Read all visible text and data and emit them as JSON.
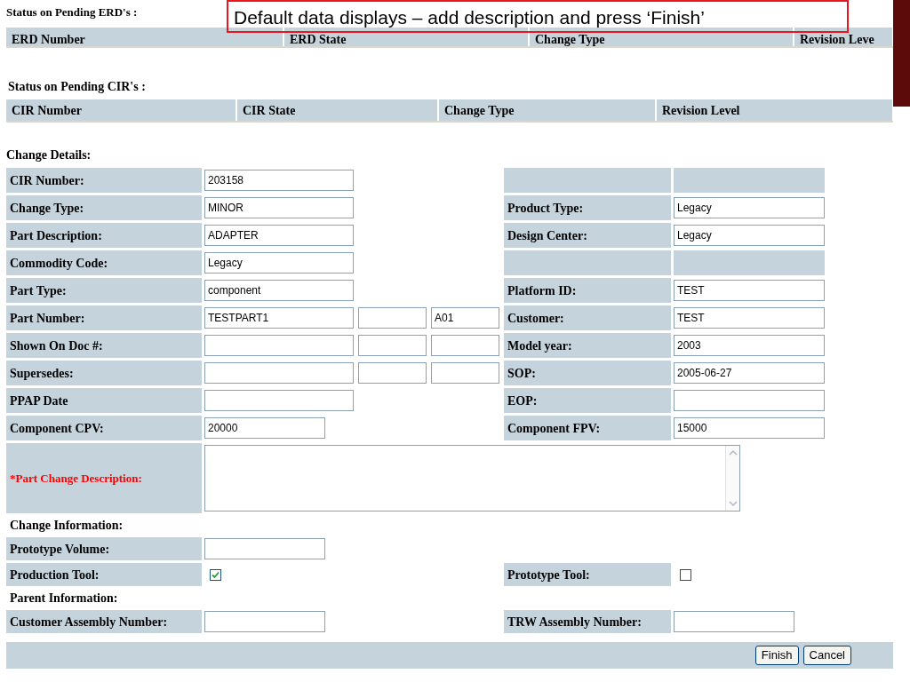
{
  "callout": {
    "text": "Default data displays – add description and press ‘Finish’"
  },
  "erd_section": {
    "title": "Status on Pending ERD's :",
    "columns": [
      "ERD Number",
      "ERD State",
      "Change Type",
      "Revision Leve"
    ]
  },
  "cir_section": {
    "title": "Status on Pending CIR's :",
    "columns": [
      "CIR Number",
      "CIR State",
      "Change Type",
      "Revision Level"
    ]
  },
  "change_details": {
    "title": "Change Details:",
    "rows": [
      {
        "label": "CIR Number:",
        "fields": [
          {
            "value": "203158"
          }
        ],
        "right": {
          "kind": "blank"
        }
      },
      {
        "label": "Change Type:",
        "fields": [
          {
            "value": "MINOR"
          }
        ],
        "right": {
          "kind": "field",
          "label": "Product Type:",
          "value": "Legacy"
        }
      },
      {
        "label": "Part Description:",
        "fields": [
          {
            "value": "ADAPTER"
          }
        ],
        "right": {
          "kind": "field",
          "label": "Design Center:",
          "value": "Legacy"
        }
      },
      {
        "label": "Commodity Code:",
        "fields": [
          {
            "value": "Legacy"
          }
        ],
        "right": {
          "kind": "blank"
        }
      },
      {
        "label": "Part Type:",
        "fields": [
          {
            "value": "component"
          }
        ],
        "right": {
          "kind": "field",
          "label": "Platform ID:",
          "value": "TEST"
        }
      },
      {
        "label": "Part Number:",
        "fields": [
          {
            "kind": "text",
            "value": "TESTPART1"
          },
          {
            "kind": "empty"
          },
          {
            "kind": "text",
            "value": "A01"
          }
        ],
        "right": {
          "kind": "field",
          "label": "Customer:",
          "value": "TEST"
        }
      },
      {
        "label": "Shown On Doc #:",
        "fields": [
          {
            "kind": "empty"
          },
          {
            "kind": "empty"
          },
          {
            "kind": "empty"
          }
        ],
        "right": {
          "kind": "field",
          "label": "Model year:",
          "value": "2003"
        }
      },
      {
        "label": "Supersedes:",
        "fields": [
          {
            "kind": "empty"
          },
          {
            "kind": "empty"
          },
          {
            "kind": "empty"
          }
        ],
        "right": {
          "kind": "field",
          "label": "SOP:",
          "value": "2005-06-27"
        }
      },
      {
        "label": "PPAP Date",
        "fields": [
          {
            "kind": "empty"
          }
        ],
        "right": {
          "kind": "field",
          "label": "EOP:"
        }
      },
      {
        "label": "Component CPV:",
        "fields": [
          {
            "value": "20000",
            "kind": "short"
          }
        ],
        "right": {
          "kind": "field",
          "label": "Component FPV:",
          "value": "15000"
        }
      }
    ],
    "description": {
      "label": "*Part Change Description:",
      "required": true
    }
  },
  "change_information": {
    "title": "Change Information:",
    "prototype_volume": {
      "label": "Prototype Volume:"
    },
    "production_tool": {
      "label": "Production Tool:",
      "checked": true
    },
    "prototype_tool": {
      "label": "Prototype Tool:",
      "checked": false
    }
  },
  "parent_information": {
    "title": "Parent Information:",
    "customer_assembly": {
      "label": "Customer Assembly Number:"
    },
    "trw_assembly": {
      "label": "TRW Assembly Number:"
    }
  },
  "buttons": [
    "Finish",
    "Cancel"
  ]
}
